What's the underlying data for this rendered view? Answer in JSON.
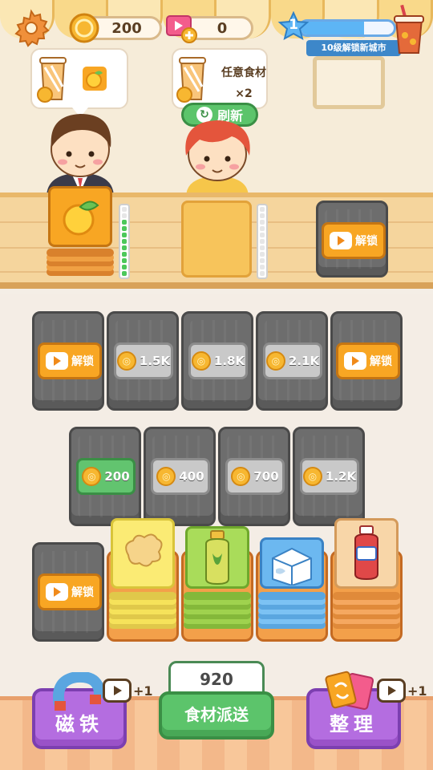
{
  "top_bar": {
    "coins": "200",
    "tickets": "0",
    "level": "1",
    "level_progress": 0.68,
    "level_caption": "10级解锁新城市"
  },
  "customers": [
    {
      "order_icon": "orange-icon",
      "order_text": ""
    },
    {
      "order_icon": "any-ingredient-icon",
      "order_text_line1": "任意食材",
      "order_text_line2": "×2"
    }
  ],
  "refresh_label": "刷新",
  "counter": {
    "slot1_progress_on": 9,
    "slot1_progress_total": 11,
    "slot2_progress_on": 0,
    "slot2_progress_total": 11,
    "slot3_unlock_label": "解锁"
  },
  "grid_row1": [
    {
      "type": "unlock",
      "label": "解锁"
    },
    {
      "type": "price",
      "label": "1.5K"
    },
    {
      "type": "price",
      "label": "1.8K"
    },
    {
      "type": "price",
      "label": "2.1K"
    },
    {
      "type": "unlock",
      "label": "解锁"
    }
  ],
  "grid_row2": [
    {
      "type": "price",
      "label": "200",
      "afford": true
    },
    {
      "type": "price",
      "label": "400"
    },
    {
      "type": "price",
      "label": "700"
    },
    {
      "type": "price",
      "label": "1.2K"
    }
  ],
  "grid_row3": [
    {
      "type": "unlock",
      "label": "解锁"
    },
    {
      "type": "card",
      "icon": "ginger-icon"
    },
    {
      "type": "card",
      "icon": "tea-bottle-icon"
    },
    {
      "type": "card",
      "icon": "milk-carton-icon"
    },
    {
      "type": "card",
      "icon": "syrup-bottle-icon"
    }
  ],
  "bottom": {
    "magnet_label": "磁铁",
    "magnet_bonus": "+1",
    "dispatch_count": "920",
    "dispatch_label": "食材派送",
    "sort_label": "整理",
    "sort_bonus": "+1"
  },
  "colors": {
    "accent_green": "#5cc46b",
    "unlock_orange": "#f8a623",
    "purple": "#b46de0",
    "level_blue": "#5db5f5"
  }
}
